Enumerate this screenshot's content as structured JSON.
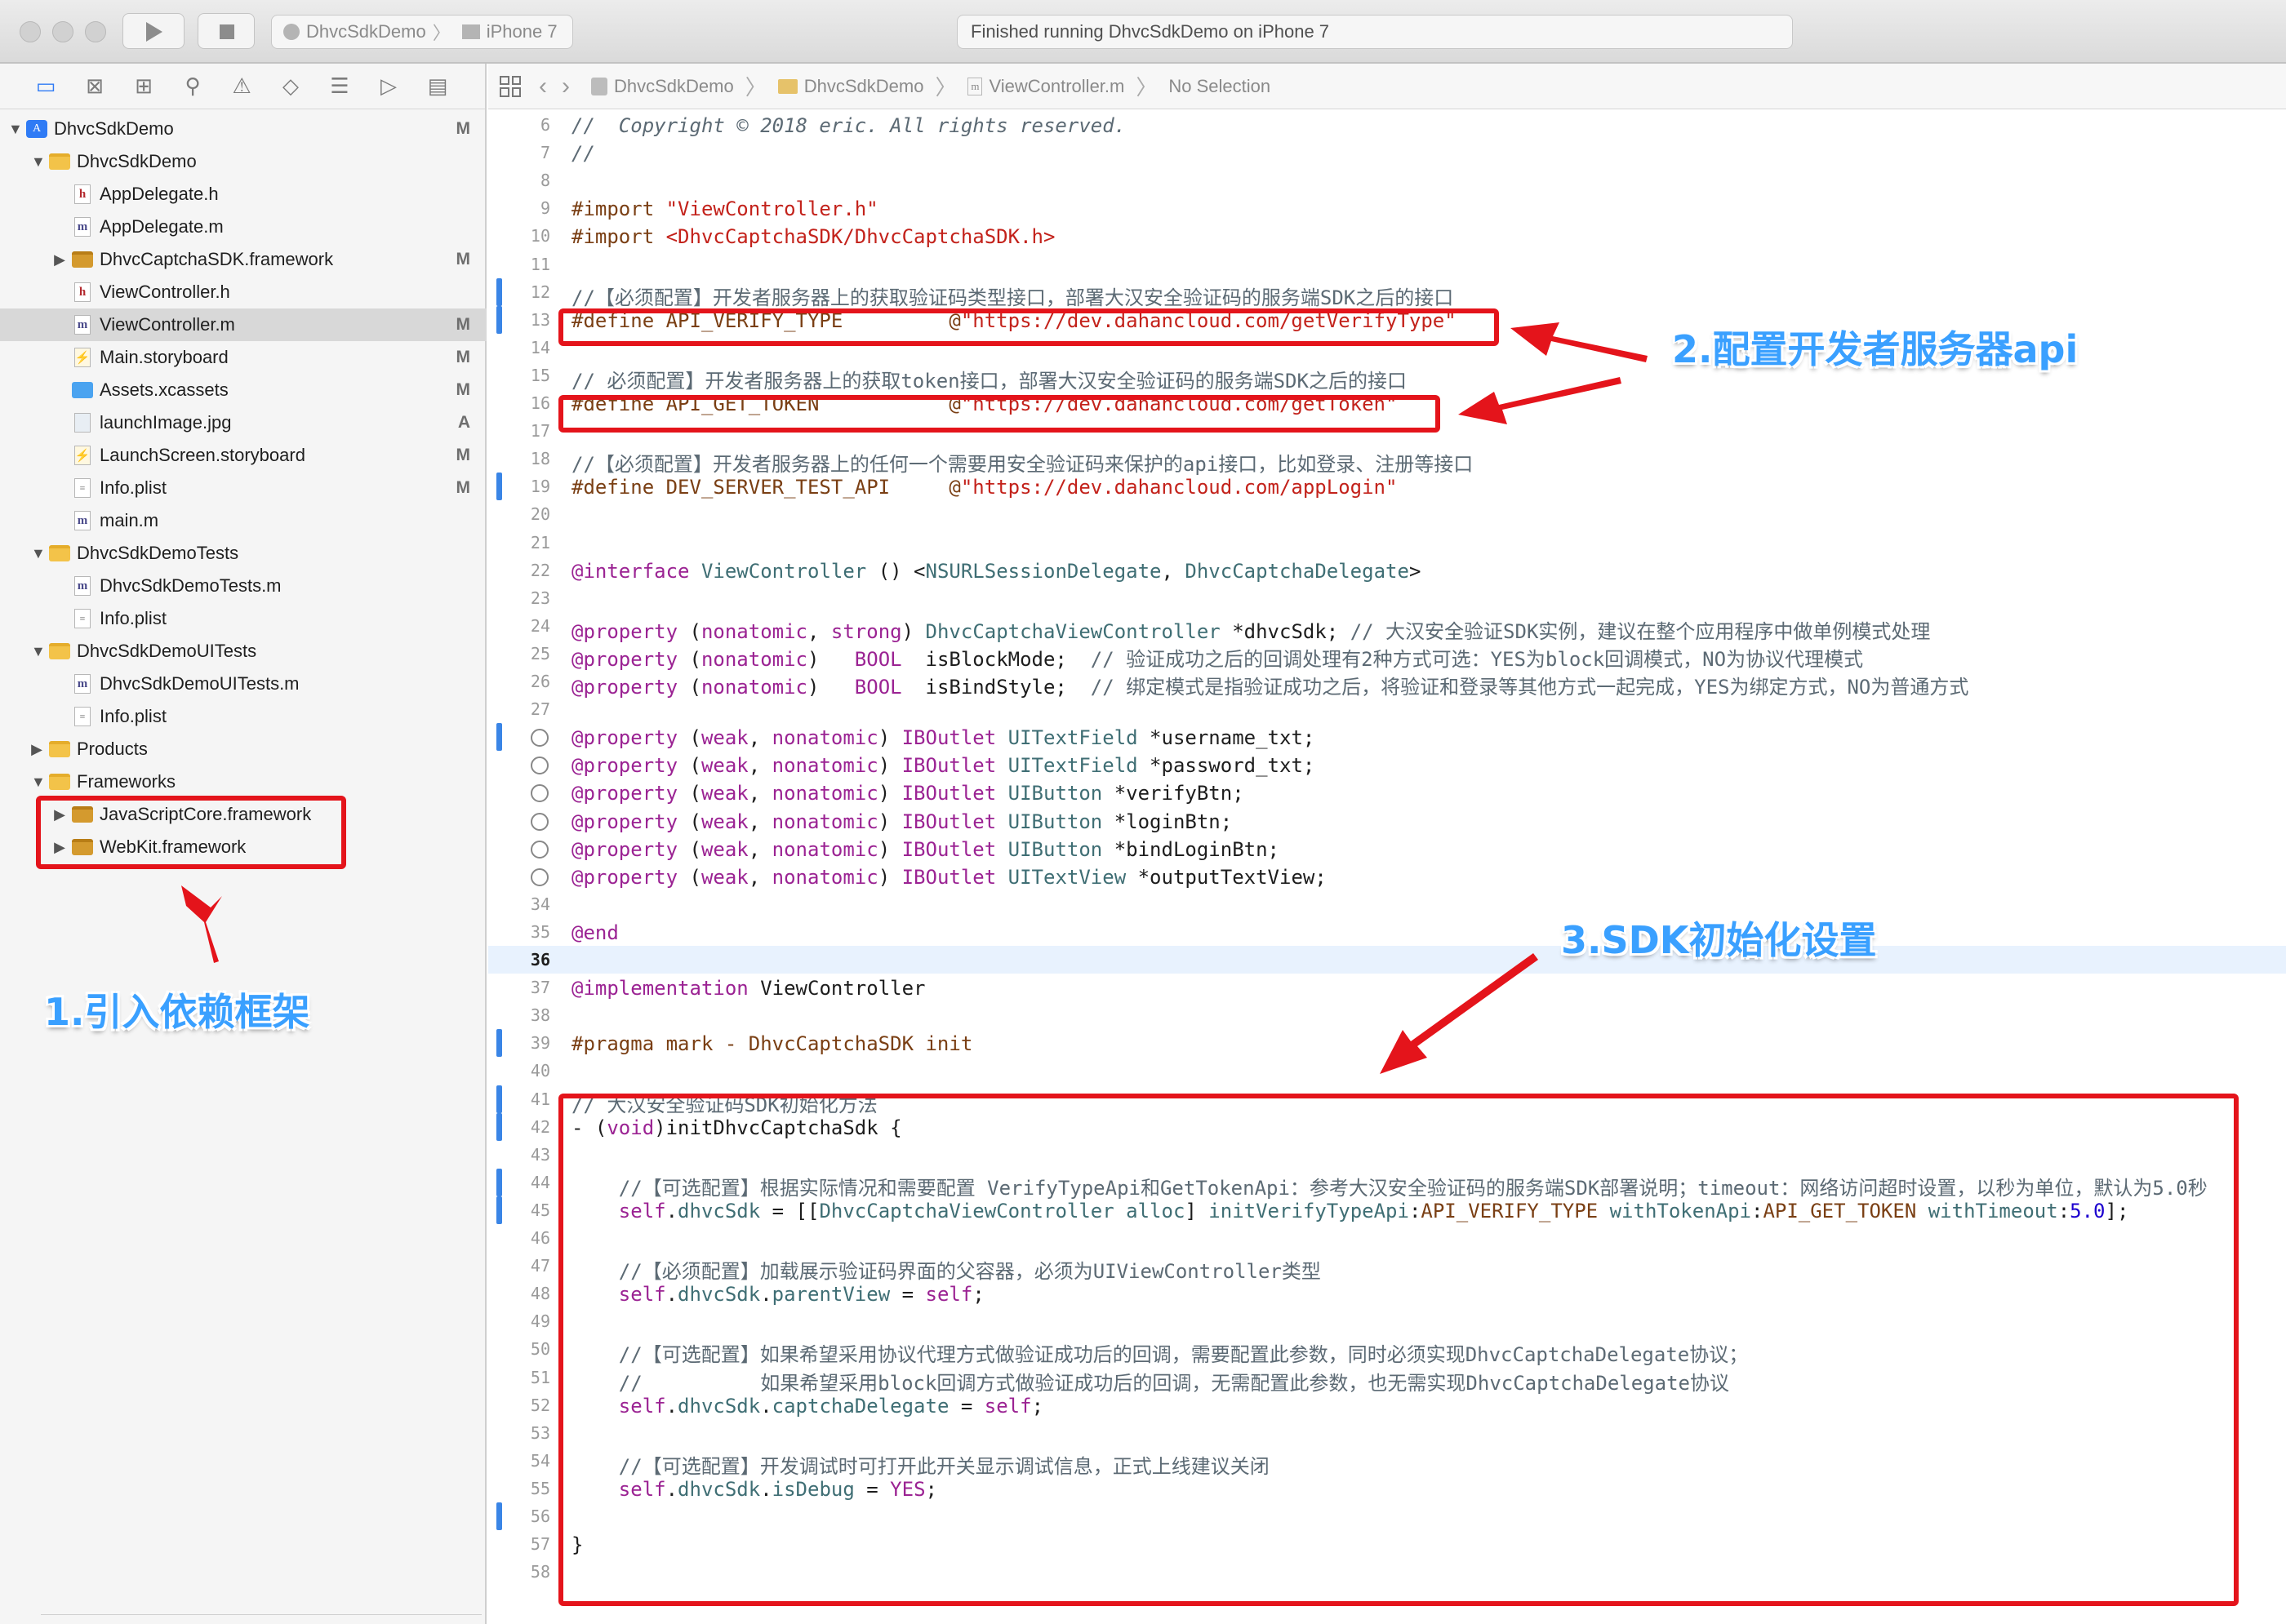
{
  "toolbar": {
    "scheme_name": "DhvcSdkDemo",
    "device_name": "iPhone 7",
    "activity_text": "Finished running DhvcSdkDemo on iPhone 7"
  },
  "navigator": {
    "tabs": [
      "folder-icon",
      "source-control-icon",
      "symbol-icon",
      "search-icon",
      "issue-icon",
      "test-icon",
      "debug-icon",
      "breakpoint-icon",
      "report-icon"
    ],
    "items": [
      {
        "label": "DhvcSdkDemo",
        "icon": "project-icon",
        "badge": "M",
        "level": 0,
        "disclosure": "▼"
      },
      {
        "label": "DhvcSdkDemo",
        "icon": "folder-icon",
        "badge": "",
        "level": 1,
        "disclosure": "▼"
      },
      {
        "label": "AppDelegate.h",
        "icon": "header-file-icon",
        "badge": "",
        "level": 2,
        "disclosure": ""
      },
      {
        "label": "AppDelegate.m",
        "icon": "source-file-icon",
        "badge": "",
        "level": 2,
        "disclosure": ""
      },
      {
        "label": "DhvcCaptchaSDK.framework",
        "icon": "framework-icon",
        "badge": "M",
        "level": 2,
        "disclosure": "▶"
      },
      {
        "label": "ViewController.h",
        "icon": "header-file-icon",
        "badge": "",
        "level": 2,
        "disclosure": ""
      },
      {
        "label": "ViewController.m",
        "icon": "source-file-icon",
        "badge": "M",
        "level": 2,
        "disclosure": "",
        "selected": true
      },
      {
        "label": "Main.storyboard",
        "icon": "storyboard-icon",
        "badge": "M",
        "level": 2,
        "disclosure": ""
      },
      {
        "label": "Assets.xcassets",
        "icon": "assets-icon",
        "badge": "M",
        "level": 2,
        "disclosure": ""
      },
      {
        "label": "launchImage.jpg",
        "icon": "image-file-icon",
        "badge": "A",
        "level": 2,
        "disclosure": ""
      },
      {
        "label": "LaunchScreen.storyboard",
        "icon": "storyboard-icon",
        "badge": "M",
        "level": 2,
        "disclosure": ""
      },
      {
        "label": "Info.plist",
        "icon": "plist-icon",
        "badge": "M",
        "level": 2,
        "disclosure": ""
      },
      {
        "label": "main.m",
        "icon": "source-file-icon",
        "badge": "",
        "level": 2,
        "disclosure": ""
      },
      {
        "label": "DhvcSdkDemoTests",
        "icon": "folder-icon",
        "badge": "",
        "level": 1,
        "disclosure": "▼"
      },
      {
        "label": "DhvcSdkDemoTests.m",
        "icon": "source-file-icon",
        "badge": "",
        "level": 2,
        "disclosure": ""
      },
      {
        "label": "Info.plist",
        "icon": "plist-icon",
        "badge": "",
        "level": 2,
        "disclosure": ""
      },
      {
        "label": "DhvcSdkDemoUITests",
        "icon": "folder-icon",
        "badge": "",
        "level": 1,
        "disclosure": "▼"
      },
      {
        "label": "DhvcSdkDemoUITests.m",
        "icon": "source-file-icon",
        "badge": "",
        "level": 2,
        "disclosure": ""
      },
      {
        "label": "Info.plist",
        "icon": "plist-icon",
        "badge": "",
        "level": 2,
        "disclosure": ""
      },
      {
        "label": "Products",
        "icon": "folder-icon",
        "badge": "",
        "level": 1,
        "disclosure": "▶"
      },
      {
        "label": "Frameworks",
        "icon": "folder-icon",
        "badge": "",
        "level": 1,
        "disclosure": "▼"
      },
      {
        "label": "JavaScriptCore.framework",
        "icon": "framework-icon",
        "badge": "",
        "level": 2,
        "disclosure": "▶"
      },
      {
        "label": "WebKit.framework",
        "icon": "framework-icon",
        "badge": "",
        "level": 2,
        "disclosure": "▶"
      }
    ]
  },
  "jumpbar": {
    "crumbs": [
      "DhvcSdkDemo",
      "DhvcSdkDemo",
      "ViewController.m",
      "No Selection"
    ]
  },
  "editor": {
    "current_line": 36,
    "lines": [
      {
        "n": 6,
        "parts": [
          [
            "cmt-it",
            "//  Copyright © 2018 eric. All rights reserved."
          ]
        ]
      },
      {
        "n": 7,
        "parts": [
          [
            "cmt-it",
            "//"
          ]
        ]
      },
      {
        "n": 8,
        "parts": []
      },
      {
        "n": 9,
        "parts": [
          [
            "pre",
            "#import "
          ],
          [
            "str",
            "\"ViewController.h\""
          ]
        ]
      },
      {
        "n": 10,
        "parts": [
          [
            "pre",
            "#import "
          ],
          [
            "str",
            "<DhvcCaptchaSDK/DhvcCaptchaSDK.h>"
          ]
        ]
      },
      {
        "n": 11,
        "parts": []
      },
      {
        "n": 12,
        "bar": true,
        "parts": [
          [
            "comment",
            "//【必须配置】开发者服务器上的获取验证码类型接口，部署大汉安全验证码的服务端SDK之后的接口"
          ]
        ]
      },
      {
        "n": 13,
        "bar": true,
        "parts": [
          [
            "pre",
            "#define API_VERIFY_TYPE         @"
          ],
          [
            "str",
            "\"https://dev.dahancloud.com/getVerifyType\""
          ]
        ]
      },
      {
        "n": 14,
        "parts": []
      },
      {
        "n": 15,
        "parts": [
          [
            "comment",
            "// 必须配置】开发者服务器上的获取token接口，部署大汉安全验证码的服务端SDK之后的接口"
          ]
        ]
      },
      {
        "n": 16,
        "parts": [
          [
            "pre",
            "#define API_GET_TOKEN           @"
          ],
          [
            "str",
            "\"https://dev.dahancloud.com/getToken\""
          ]
        ]
      },
      {
        "n": 17,
        "parts": []
      },
      {
        "n": 18,
        "parts": [
          [
            "comment",
            "//【必须配置】开发者服务器上的任何一个需要用安全验证码来保护的api接口，比如登录、注册等接口"
          ]
        ]
      },
      {
        "n": 19,
        "bar": true,
        "parts": [
          [
            "pre",
            "#define DEV_SERVER_TEST_API     @"
          ],
          [
            "str",
            "\"https://dev.dahancloud.com/appLogin\""
          ]
        ]
      },
      {
        "n": 20,
        "parts": []
      },
      {
        "n": 21,
        "parts": []
      },
      {
        "n": 22,
        "parts": [
          [
            "key",
            "@interface"
          ],
          [
            "plain",
            " "
          ],
          [
            "type",
            "ViewController"
          ],
          [
            "plain",
            " () <"
          ],
          [
            "type",
            "NSURLSessionDelegate"
          ],
          [
            "plain",
            ", "
          ],
          [
            "type",
            "DhvcCaptchaDelegate"
          ],
          [
            "plain",
            ">"
          ]
        ]
      },
      {
        "n": 23,
        "parts": []
      },
      {
        "n": 24,
        "parts": [
          [
            "key",
            "@property"
          ],
          [
            "plain",
            " ("
          ],
          [
            "key",
            "nonatomic"
          ],
          [
            "plain",
            ", "
          ],
          [
            "key",
            "strong"
          ],
          [
            "plain",
            ") "
          ],
          [
            "type",
            "DhvcCaptchaViewController"
          ],
          [
            "plain",
            " *dhvcSdk; "
          ],
          [
            "comment",
            "// 大汉安全验证SDK实例，建议在整个应用程序中做单例模式处理"
          ]
        ]
      },
      {
        "n": 25,
        "parts": [
          [
            "key",
            "@property"
          ],
          [
            "plain",
            " ("
          ],
          [
            "key",
            "nonatomic"
          ],
          [
            "plain",
            ")   "
          ],
          [
            "key",
            "BOOL"
          ],
          [
            "plain",
            "  isBlockMode;  "
          ],
          [
            "comment",
            "// 验证成功之后的回调处理有2种方式可选：YES为block回调模式，NO为协议代理模式"
          ]
        ]
      },
      {
        "n": 26,
        "parts": [
          [
            "key",
            "@property"
          ],
          [
            "plain",
            " ("
          ],
          [
            "key",
            "nonatomic"
          ],
          [
            "plain",
            ")   "
          ],
          [
            "key",
            "BOOL"
          ],
          [
            "plain",
            "  isBindStyle;  "
          ],
          [
            "comment",
            "// 绑定模式是指验证成功之后，将验证和登录等其他方式一起完成，YES为绑定方式，NO为普通方式"
          ]
        ]
      },
      {
        "n": 27,
        "parts": []
      },
      {
        "n": 28,
        "bar": true,
        "conn": true,
        "parts": [
          [
            "key",
            "@property"
          ],
          [
            "plain",
            " ("
          ],
          [
            "key",
            "weak"
          ],
          [
            "plain",
            ", "
          ],
          [
            "key",
            "nonatomic"
          ],
          [
            "plain",
            ") "
          ],
          [
            "key",
            "IBOutlet"
          ],
          [
            "plain",
            " "
          ],
          [
            "type",
            "UITextField"
          ],
          [
            "plain",
            " *username_txt;"
          ]
        ]
      },
      {
        "n": 29,
        "conn": true,
        "parts": [
          [
            "key",
            "@property"
          ],
          [
            "plain",
            " ("
          ],
          [
            "key",
            "weak"
          ],
          [
            "plain",
            ", "
          ],
          [
            "key",
            "nonatomic"
          ],
          [
            "plain",
            ") "
          ],
          [
            "key",
            "IBOutlet"
          ],
          [
            "plain",
            " "
          ],
          [
            "type",
            "UITextField"
          ],
          [
            "plain",
            " *password_txt;"
          ]
        ]
      },
      {
        "n": 30,
        "conn": true,
        "parts": [
          [
            "key",
            "@property"
          ],
          [
            "plain",
            " ("
          ],
          [
            "key",
            "weak"
          ],
          [
            "plain",
            ", "
          ],
          [
            "key",
            "nonatomic"
          ],
          [
            "plain",
            ") "
          ],
          [
            "key",
            "IBOutlet"
          ],
          [
            "plain",
            " "
          ],
          [
            "type",
            "UIButton"
          ],
          [
            "plain",
            " *verifyBtn;"
          ]
        ]
      },
      {
        "n": 31,
        "conn": true,
        "parts": [
          [
            "key",
            "@property"
          ],
          [
            "plain",
            " ("
          ],
          [
            "key",
            "weak"
          ],
          [
            "plain",
            ", "
          ],
          [
            "key",
            "nonatomic"
          ],
          [
            "plain",
            ") "
          ],
          [
            "key",
            "IBOutlet"
          ],
          [
            "plain",
            " "
          ],
          [
            "type",
            "UIButton"
          ],
          [
            "plain",
            " *loginBtn;"
          ]
        ]
      },
      {
        "n": 32,
        "conn": true,
        "parts": [
          [
            "key",
            "@property"
          ],
          [
            "plain",
            " ("
          ],
          [
            "key",
            "weak"
          ],
          [
            "plain",
            ", "
          ],
          [
            "key",
            "nonatomic"
          ],
          [
            "plain",
            ") "
          ],
          [
            "key",
            "IBOutlet"
          ],
          [
            "plain",
            " "
          ],
          [
            "type",
            "UIButton"
          ],
          [
            "plain",
            " *bindLoginBtn;"
          ]
        ]
      },
      {
        "n": 33,
        "conn": true,
        "parts": [
          [
            "key",
            "@property"
          ],
          [
            "plain",
            " ("
          ],
          [
            "key",
            "weak"
          ],
          [
            "plain",
            ", "
          ],
          [
            "key",
            "nonatomic"
          ],
          [
            "plain",
            ") "
          ],
          [
            "key",
            "IBOutlet"
          ],
          [
            "plain",
            " "
          ],
          [
            "type",
            "UITextView"
          ],
          [
            "plain",
            " *outputTextView;"
          ]
        ]
      },
      {
        "n": 34,
        "parts": []
      },
      {
        "n": 35,
        "parts": [
          [
            "key",
            "@end"
          ]
        ]
      },
      {
        "n": 36,
        "parts": []
      },
      {
        "n": 37,
        "parts": [
          [
            "key",
            "@implementation"
          ],
          [
            "plain",
            " ViewController"
          ]
        ]
      },
      {
        "n": 38,
        "parts": []
      },
      {
        "n": 39,
        "bar": true,
        "parts": [
          [
            "pre",
            "#pragma mark - DhvcCaptchaSDK init"
          ]
        ]
      },
      {
        "n": 40,
        "parts": []
      },
      {
        "n": 41,
        "bar": true,
        "parts": [
          [
            "comment",
            "// 大汉安全验证码SDK初始化方法"
          ]
        ]
      },
      {
        "n": 42,
        "bar": true,
        "parts": [
          [
            "plain",
            "- ("
          ],
          [
            "key",
            "void"
          ],
          [
            "plain",
            ")initDhvcCaptchaSdk {"
          ]
        ]
      },
      {
        "n": 43,
        "parts": []
      },
      {
        "n": 44,
        "bar": true,
        "parts": [
          [
            "comment",
            "    //【可选配置】根据实际情况和需要配置 VerifyTypeApi和GetTokenApi：参考大汉安全验证码的服务端SDK部署说明；timeout：网络访问超时设置，以秒为单位，默认为5.0秒"
          ]
        ]
      },
      {
        "n": 45,
        "bar": true,
        "parts": [
          [
            "plain",
            "    "
          ],
          [
            "key",
            "self"
          ],
          [
            "plain",
            "."
          ],
          [
            "type",
            "dhvcSdk"
          ],
          [
            "plain",
            " = [["
          ],
          [
            "type",
            "DhvcCaptchaViewController"
          ],
          [
            "plain",
            " "
          ],
          [
            "type",
            "alloc"
          ],
          [
            "plain",
            "] "
          ],
          [
            "type",
            "initVerifyTypeApi"
          ],
          [
            "plain",
            ":"
          ],
          [
            "pre",
            "API_VERIFY_TYPE"
          ],
          [
            "plain",
            " "
          ],
          [
            "type",
            "withTokenApi"
          ],
          [
            "plain",
            ":"
          ],
          [
            "pre",
            "API_GET_TOKEN"
          ],
          [
            "plain",
            " "
          ],
          [
            "type",
            "withTimeout"
          ],
          [
            "plain",
            ":"
          ],
          [
            "num",
            "5.0"
          ],
          [
            "plain",
            "];"
          ]
        ]
      },
      {
        "n": 46,
        "parts": []
      },
      {
        "n": 47,
        "parts": [
          [
            "comment",
            "    //【必须配置】加载展示验证码界面的父容器，必须为UIViewController类型"
          ]
        ]
      },
      {
        "n": 48,
        "parts": [
          [
            "plain",
            "    "
          ],
          [
            "key",
            "self"
          ],
          [
            "plain",
            "."
          ],
          [
            "type",
            "dhvcSdk"
          ],
          [
            "plain",
            "."
          ],
          [
            "type",
            "parentView"
          ],
          [
            "plain",
            " = "
          ],
          [
            "key",
            "self"
          ],
          [
            "plain",
            ";"
          ]
        ]
      },
      {
        "n": 49,
        "parts": []
      },
      {
        "n": 50,
        "parts": [
          [
            "comment",
            "    //【可选配置】如果希望采用协议代理方式做验证成功后的回调，需要配置此参数，同时必须实现DhvcCaptchaDelegate协议；"
          ]
        ]
      },
      {
        "n": 51,
        "parts": [
          [
            "comment",
            "    //          如果希望采用block回调方式做验证成功后的回调，无需配置此参数，也无需实现DhvcCaptchaDelegate协议"
          ]
        ]
      },
      {
        "n": 52,
        "parts": [
          [
            "plain",
            "    "
          ],
          [
            "key",
            "self"
          ],
          [
            "plain",
            "."
          ],
          [
            "type",
            "dhvcSdk"
          ],
          [
            "plain",
            "."
          ],
          [
            "type",
            "captchaDelegate"
          ],
          [
            "plain",
            " = "
          ],
          [
            "key",
            "self"
          ],
          [
            "plain",
            ";"
          ]
        ]
      },
      {
        "n": 53,
        "parts": []
      },
      {
        "n": 54,
        "parts": [
          [
            "comment",
            "    //【可选配置】开发调试时可打开此开关显示调试信息，正式上线建议关闭"
          ]
        ]
      },
      {
        "n": 55,
        "parts": [
          [
            "plain",
            "    "
          ],
          [
            "key",
            "self"
          ],
          [
            "plain",
            "."
          ],
          [
            "type",
            "dhvcSdk"
          ],
          [
            "plain",
            "."
          ],
          [
            "type",
            "isDebug"
          ],
          [
            "plain",
            " = "
          ],
          [
            "key",
            "YES"
          ],
          [
            "plain",
            ";"
          ]
        ]
      },
      {
        "n": 56,
        "bar": true,
        "parts": []
      },
      {
        "n": 57,
        "parts": [
          [
            "plain",
            "}"
          ]
        ]
      },
      {
        "n": 58,
        "parts": []
      }
    ]
  },
  "annotations": {
    "callout_1": "1.引入依赖框架",
    "callout_2": "2.配置开发者服务器api",
    "callout_3": "3.SDK初始化设置",
    "color": "#e4141b",
    "text_color": "#3aa0ff"
  }
}
